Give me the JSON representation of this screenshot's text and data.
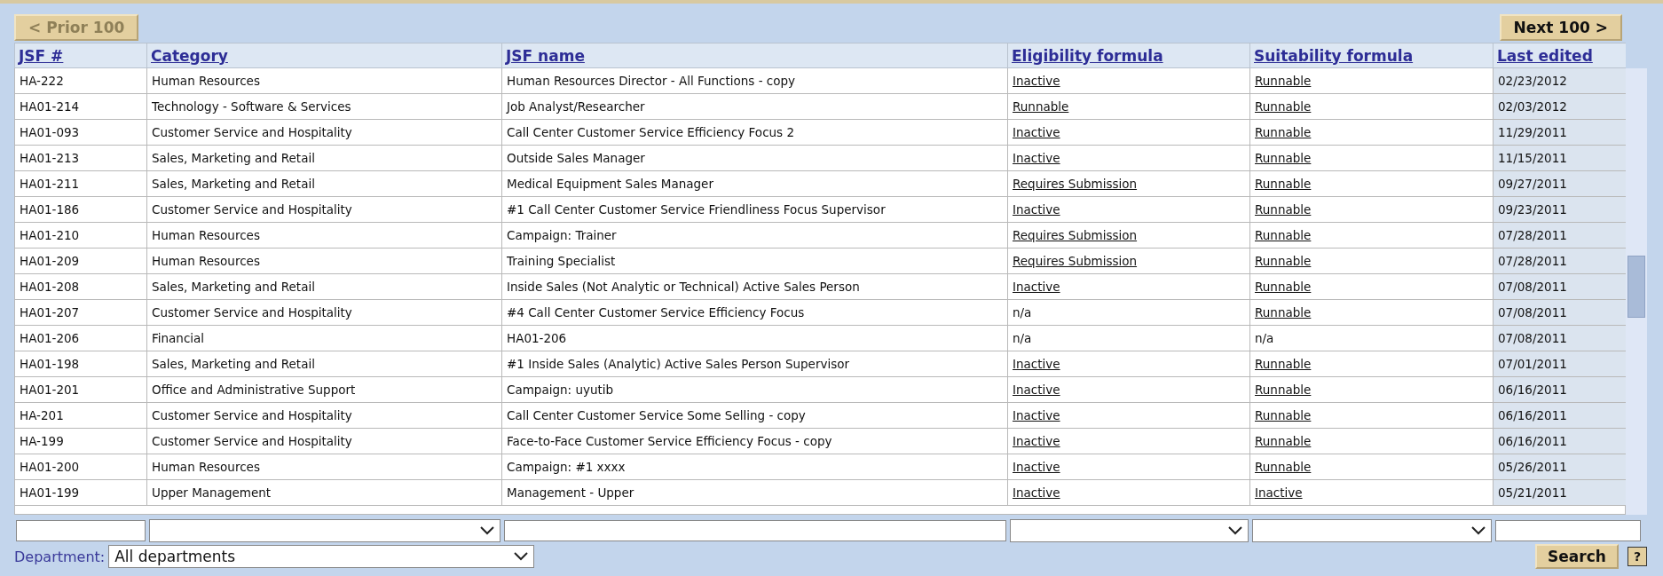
{
  "pager": {
    "prior": {
      "label": "< Prior 100",
      "disabled": true
    },
    "next": {
      "label": "Next 100 >",
      "disabled": false
    }
  },
  "table": {
    "columns": [
      "JSF #",
      "Category",
      "JSF name",
      "Eligibility formula",
      "Suitability formula",
      "Last edited"
    ],
    "rows": [
      {
        "jsf": "HA-222",
        "category": "Human Resources",
        "name": "Human Resources Director - All Functions - copy",
        "eligibility": {
          "text": "Inactive",
          "link": true
        },
        "suitability": {
          "text": "Runnable",
          "link": true
        },
        "edited": "02/23/2012"
      },
      {
        "jsf": "HA01-214",
        "category": "Technology - Software & Services",
        "name": "Job Analyst/Researcher",
        "eligibility": {
          "text": "Runnable",
          "link": true
        },
        "suitability": {
          "text": "Runnable",
          "link": true
        },
        "edited": "02/03/2012"
      },
      {
        "jsf": "HA01-093",
        "category": "Customer Service and Hospitality",
        "name": "Call Center Customer Service Efficiency Focus 2",
        "eligibility": {
          "text": "Inactive",
          "link": true
        },
        "suitability": {
          "text": "Runnable",
          "link": true
        },
        "edited": "11/29/2011"
      },
      {
        "jsf": "HA01-213",
        "category": "Sales, Marketing and Retail",
        "name": "Outside Sales Manager",
        "eligibility": {
          "text": "Inactive",
          "link": true
        },
        "suitability": {
          "text": "Runnable",
          "link": true
        },
        "edited": "11/15/2011"
      },
      {
        "jsf": "HA01-211",
        "category": "Sales, Marketing and Retail",
        "name": "Medical Equipment Sales Manager",
        "eligibility": {
          "text": "Requires Submission",
          "link": true
        },
        "suitability": {
          "text": "Runnable",
          "link": true
        },
        "edited": "09/27/2011"
      },
      {
        "jsf": "HA01-186",
        "category": "Customer Service and Hospitality",
        "name": "#1 Call Center Customer Service Friendliness Focus Supervisor",
        "eligibility": {
          "text": "Inactive",
          "link": true
        },
        "suitability": {
          "text": "Runnable",
          "link": true
        },
        "edited": "09/23/2011"
      },
      {
        "jsf": "HA01-210",
        "category": "Human Resources",
        "name": "Campaign: Trainer",
        "eligibility": {
          "text": "Requires Submission",
          "link": true
        },
        "suitability": {
          "text": "Runnable",
          "link": true
        },
        "edited": "07/28/2011"
      },
      {
        "jsf": "HA01-209",
        "category": "Human Resources",
        "name": "Training Specialist",
        "eligibility": {
          "text": "Requires Submission",
          "link": true
        },
        "suitability": {
          "text": "Runnable",
          "link": true
        },
        "edited": "07/28/2011"
      },
      {
        "jsf": "HA01-208",
        "category": "Sales, Marketing and Retail",
        "name": "Inside Sales (Not Analytic or Technical) Active Sales Person",
        "eligibility": {
          "text": "Inactive",
          "link": true
        },
        "suitability": {
          "text": "Runnable",
          "link": true
        },
        "edited": "07/08/2011"
      },
      {
        "jsf": "HA01-207",
        "category": "Customer Service and Hospitality",
        "name": "#4 Call Center Customer Service Efficiency Focus",
        "eligibility": {
          "text": "n/a",
          "link": false
        },
        "suitability": {
          "text": "Runnable",
          "link": true
        },
        "edited": "07/08/2011"
      },
      {
        "jsf": "HA01-206",
        "category": "Financial",
        "name": "HA01-206",
        "eligibility": {
          "text": "n/a",
          "link": false
        },
        "suitability": {
          "text": "n/a",
          "link": false
        },
        "edited": "07/08/2011"
      },
      {
        "jsf": "HA01-198",
        "category": "Sales, Marketing and Retail",
        "name": "#1 Inside Sales (Analytic) Active Sales Person Supervisor",
        "eligibility": {
          "text": "Inactive",
          "link": true
        },
        "suitability": {
          "text": "Runnable",
          "link": true
        },
        "edited": "07/01/2011"
      },
      {
        "jsf": "HA01-201",
        "category": "Office and Administrative Support",
        "name": "Campaign: uyutib",
        "eligibility": {
          "text": "Inactive",
          "link": true
        },
        "suitability": {
          "text": "Runnable",
          "link": true
        },
        "edited": "06/16/2011"
      },
      {
        "jsf": "HA-201",
        "category": "Customer Service and Hospitality",
        "name": "Call Center Customer Service Some Selling - copy",
        "eligibility": {
          "text": "Inactive",
          "link": true
        },
        "suitability": {
          "text": "Runnable",
          "link": true
        },
        "edited": "06/16/2011"
      },
      {
        "jsf": "HA-199",
        "category": "Customer Service and Hospitality",
        "name": "Face-to-Face Customer Service Efficiency Focus - copy",
        "eligibility": {
          "text": "Inactive",
          "link": true
        },
        "suitability": {
          "text": "Runnable",
          "link": true
        },
        "edited": "06/16/2011"
      },
      {
        "jsf": "HA01-200",
        "category": "Human Resources",
        "name": "Campaign: #1 xxxx",
        "eligibility": {
          "text": "Inactive",
          "link": true
        },
        "suitability": {
          "text": "Runnable",
          "link": true
        },
        "edited": "05/26/2011"
      },
      {
        "jsf": "HA01-199",
        "category": "Upper Management",
        "name": "Management - Upper",
        "eligibility": {
          "text": "Inactive",
          "link": true
        },
        "suitability": {
          "text": "Inactive",
          "link": true
        },
        "edited": "05/21/2011"
      }
    ]
  },
  "filters": [
    {
      "kind": "text"
    },
    {
      "kind": "select"
    },
    {
      "kind": "text"
    },
    {
      "kind": "select"
    },
    {
      "kind": "select"
    },
    {
      "kind": "text"
    }
  ],
  "department": {
    "label": "Department:",
    "value": "All departments"
  },
  "search_button": "Search",
  "help_icon": "?"
}
